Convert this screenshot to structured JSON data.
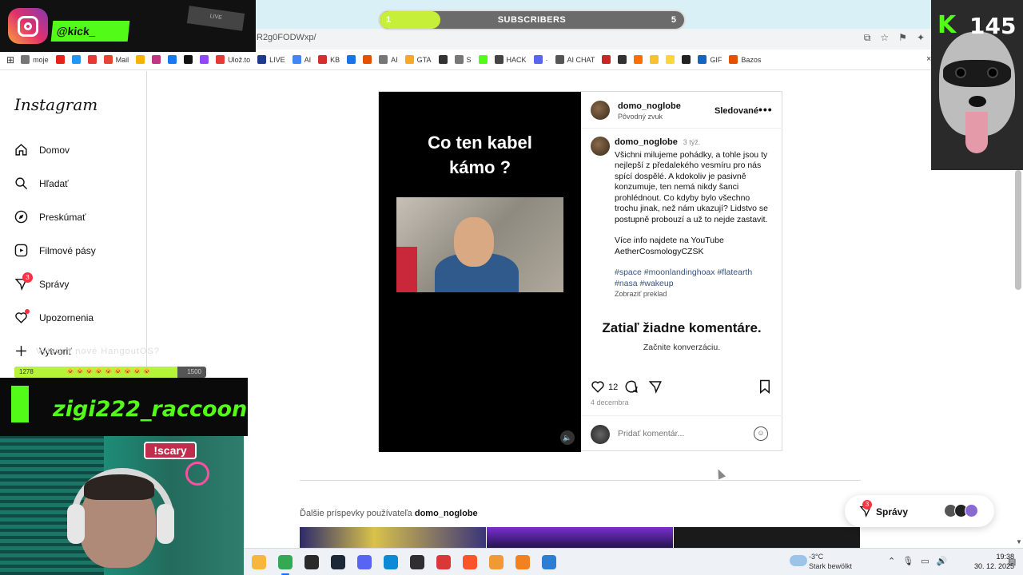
{
  "browser": {
    "url": "R2g0FODWxp/",
    "bookmarks": [
      {
        "label": "moje",
        "color": "#777"
      },
      {
        "label": "",
        "color": "#e62117"
      },
      {
        "label": "",
        "color": "#2196f3"
      },
      {
        "label": "",
        "color": "#e53935"
      },
      {
        "label": "Mail",
        "color": "#ea4335"
      },
      {
        "label": "",
        "color": "#f4b400"
      },
      {
        "label": "",
        "color": "#c13584"
      },
      {
        "label": "",
        "color": "#1877f2"
      },
      {
        "label": "",
        "color": "#111"
      },
      {
        "label": "",
        "color": "#9146ff"
      },
      {
        "label": "Ulož.to",
        "color": "#e53935"
      },
      {
        "label": "LIVE",
        "color": "#1e3a8a"
      },
      {
        "label": "AI",
        "color": "#4285f4"
      },
      {
        "label": "KB",
        "color": "#d32f2f"
      },
      {
        "label": "",
        "color": "#1a73e8"
      },
      {
        "label": "",
        "color": "#e65100"
      },
      {
        "label": "AI",
        "color": "#777"
      },
      {
        "label": "GTA",
        "color": "#f9a825"
      },
      {
        "label": "",
        "color": "#333"
      },
      {
        "label": "S",
        "color": "#777"
      },
      {
        "label": "",
        "color": "#53fc18"
      },
      {
        "label": "HACK",
        "color": "#444"
      },
      {
        "label": "·",
        "color": "#5865f2"
      },
      {
        "label": "AI CHAT",
        "color": "#555"
      },
      {
        "label": "",
        "color": "#c62828"
      },
      {
        "label": "",
        "color": "#333"
      },
      {
        "label": "",
        "color": "#ff6f00"
      },
      {
        "label": "",
        "color": "#fbc02d"
      },
      {
        "label": "",
        "color": "#fdd835"
      },
      {
        "label": "",
        "color": "#222"
      },
      {
        "label": "GIF",
        "color": "#1565c0"
      },
      {
        "label": "Bazos",
        "color": "#e65100"
      }
    ],
    "close_label": "×"
  },
  "subscribers_bar": {
    "label": "SUBSCRIBERS",
    "current": "1",
    "goal": "5",
    "progress": 0.2,
    "fill_color": "#c6ef3a"
  },
  "stream_overlay": {
    "kick_handle": "@kick_",
    "kick_count": "145",
    "kick_letter": "K",
    "deco_text": "LIVE",
    "streamer_name": "zigi222_raccoon",
    "scary_sign": "!scary",
    "ticker_text": "Vytvoriť nové HangoutOS?",
    "progress_left": "1278",
    "progress_mid": "🐱🐱🐱🐱🐱🐱🐱🐱🐱",
    "progress_right": "1500",
    "progress_value": 0.85,
    "brand_color": "#53fc18"
  },
  "instagram": {
    "wordmark": "Instagram",
    "nav": [
      {
        "label": "Domov",
        "icon": "home-icon"
      },
      {
        "label": "Hľadať",
        "icon": "search-icon"
      },
      {
        "label": "Preskúmať",
        "icon": "compass-icon"
      },
      {
        "label": "Filmové pásy",
        "icon": "reels-icon"
      },
      {
        "label": "Správy",
        "icon": "messenger-icon",
        "badge": "3"
      },
      {
        "label": "Upozornenia",
        "icon": "heart-icon"
      },
      {
        "label": "Vytvoriť",
        "icon": "plus-icon"
      }
    ],
    "post": {
      "video_title": "Co ten kabel\nkámo ?",
      "username": "domo_noglobe",
      "audio": "Pôvodný zvuk",
      "follow_state": "Sledované",
      "more": "•••",
      "caption_user": "domo_noglobe",
      "caption_time": "3 týž.",
      "caption_text": "Všichni milujeme pohádky, a tohle jsou ty nejlepší z předalekého vesmíru pro nás spící dospělé. A kdokoliv je pasivně konzumuje, ten nemá nikdy šanci prohlédnout. Co kdyby bylo všechno trochu jinak, než nám ukazují? Lidstvo se postupně probouzí a už to nejde zastavit.",
      "caption_more": "Více info najdete na YouTube AetherCosmologyCZSK",
      "caption_tags": "#space #moonlandinghoax #flatearth #nasa  #wakeup",
      "translate": "Zobraziť preklad",
      "no_comments": "Zatiaľ žiadne komentáre.",
      "start_conversation": "Začnite konverzáciu.",
      "likes": "12",
      "date": "4 decembra",
      "comment_placeholder": "Pridať komentár..."
    },
    "more_posts_prefix": "Ďalšie príspevky používateľa ",
    "more_posts_user": "domo_noglobe",
    "messages_pill": {
      "label": "Správy",
      "badge": "3"
    }
  },
  "taskbar": {
    "weather_temp": "-3°C",
    "weather_desc": "Stark bewölkt",
    "time": "19:38",
    "date": "30. 12. 2025",
    "apps": [
      {
        "name": "file-explorer-icon",
        "color": "#f6b73c"
      },
      {
        "name": "chrome-icon",
        "color": "#34a853"
      },
      {
        "name": "epic-games-icon",
        "color": "#2a2a2a"
      },
      {
        "name": "steam-icon",
        "color": "#1b2838"
      },
      {
        "name": "discord-icon",
        "color": "#5865f2"
      },
      {
        "name": "edge-icon",
        "color": "#0c8ad6"
      },
      {
        "name": "obs-icon",
        "color": "#302e31"
      },
      {
        "name": "game-icon",
        "color": "#d93838"
      },
      {
        "name": "brave-icon",
        "color": "#fb542b"
      },
      {
        "name": "app-orange-icon",
        "color": "#f09a36"
      },
      {
        "name": "vlc-icon",
        "color": "#f48120"
      },
      {
        "name": "app-blue-icon",
        "color": "#2d7dd2"
      }
    ]
  }
}
